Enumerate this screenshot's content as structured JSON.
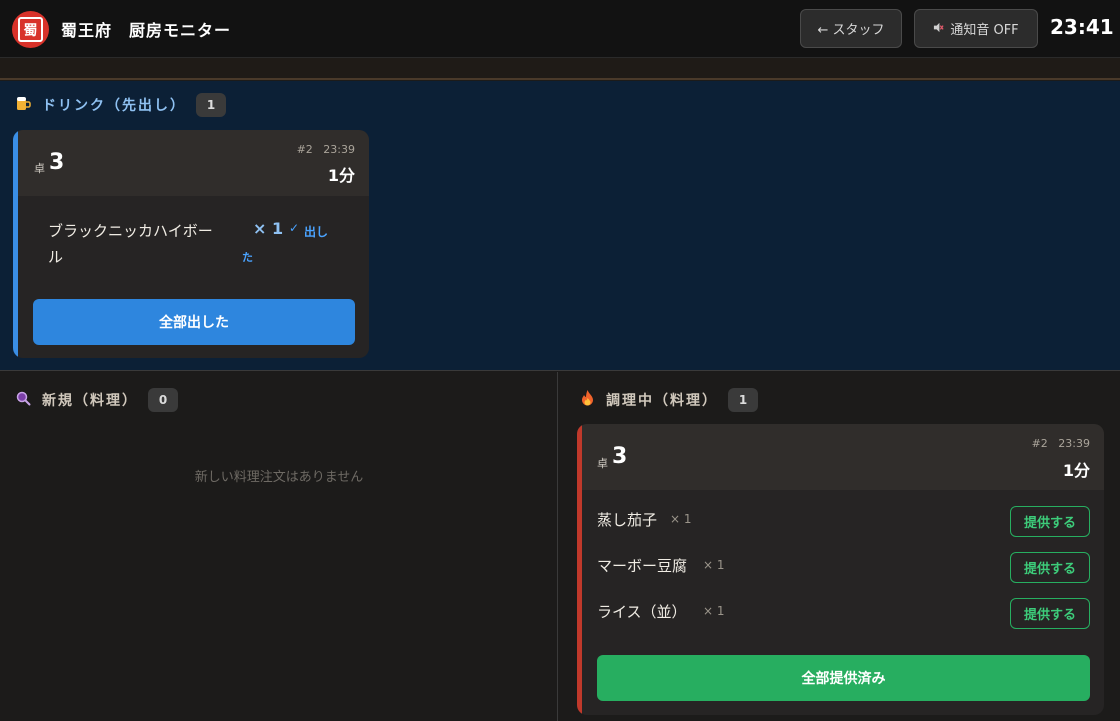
{
  "header": {
    "logo_char": "蜀",
    "title": "蜀王府　厨房モニター",
    "staff_button": "← スタッフ",
    "sound_icon": "speaker-muted-icon",
    "sound_button": "通知音 OFF",
    "clock": "23:41"
  },
  "drink": {
    "icon": "beer-icon",
    "title": "ドリンク（先出し）",
    "count": "1",
    "card": {
      "table_prefix": "卓",
      "table_number": "3",
      "order_no": "#2",
      "order_time": "23:39",
      "elapsed": "1分",
      "item_name_line1": "ブラックニッカハイボー",
      "item_name_line2": "ル",
      "qty": "× 1",
      "served_mark": "✓",
      "served_line1": "出し",
      "served_line2": "た",
      "all_button": "全部出した"
    }
  },
  "new_food": {
    "icon": "search-icon",
    "title": "新規（料理）",
    "count": "0",
    "empty_message": "新しい料理注文はありません"
  },
  "cooking": {
    "icon": "fire-icon",
    "title": "調理中（料理）",
    "count": "1",
    "card": {
      "table_prefix": "卓",
      "table_number": "3",
      "order_no": "#2",
      "order_time": "23:39",
      "elapsed": "1分",
      "items": [
        {
          "name": "蒸し茄子",
          "qty": "× 1",
          "button": "提供する"
        },
        {
          "name": "マーボー豆腐",
          "qty": "× 1",
          "button": "提供する"
        },
        {
          "name": "ライス（並）",
          "qty": "× 1",
          "button": "提供する"
        }
      ],
      "all_button": "全部提供済み"
    }
  },
  "colors": {
    "drink_accent": "#3a8ee6",
    "cooking_accent": "#c0392b",
    "drink_button": "#2e86de",
    "serve_button": "#27ae60",
    "drink_bg": "#0c2036"
  }
}
